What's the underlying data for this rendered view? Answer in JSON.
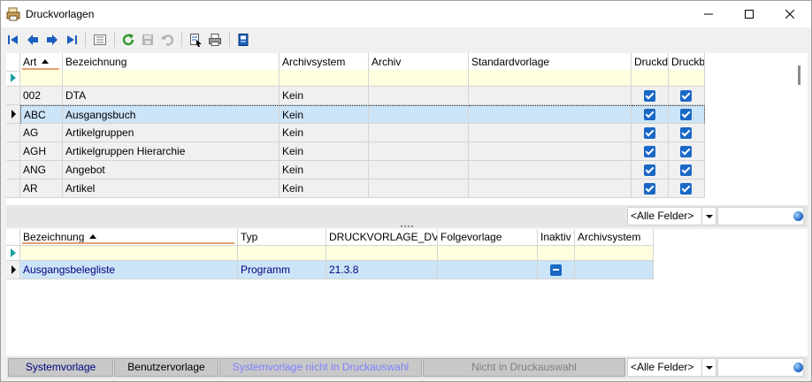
{
  "window": {
    "title": "Druckvorlagen"
  },
  "upper_grid": {
    "columns": [
      "Art",
      "Bezeichnung",
      "Archivsystem",
      "Archiv",
      "Standardvorlage",
      "Druckdi",
      "Druckbe"
    ],
    "rows": [
      {
        "art": "002",
        "bezeichnung": "DTA",
        "archivsystem": "Kein"
      },
      {
        "art": "ABC",
        "bezeichnung": "Ausgangsbuch",
        "archivsystem": "Kein"
      },
      {
        "art": "AG",
        "bezeichnung": "Artikelgruppen",
        "archivsystem": "Kein"
      },
      {
        "art": "AGH",
        "bezeichnung": "Artikelgruppen Hierarchie",
        "archivsystem": "Kein"
      },
      {
        "art": "ANG",
        "bezeichnung": "Angebot",
        "archivsystem": "Kein"
      },
      {
        "art": "AR",
        "bezeichnung": "Artikel",
        "archivsystem": "Kein"
      }
    ],
    "filter": "<Alle Felder>"
  },
  "lower_grid": {
    "columns": [
      "Bezeichnung",
      "Typ",
      "DRUCKVORLAGE_DV_R",
      "Folgevorlage",
      "Inaktiv",
      "Archivsystem"
    ],
    "rows": [
      {
        "bezeichnung": "Ausgangsbelegliste",
        "typ": "Programm",
        "dv": "21.3.8"
      }
    ],
    "filter": "<Alle Felder>"
  },
  "legend": {
    "systemvorlage": "Systemvorlage",
    "benutzervorlage": "Benutzervorlage",
    "system_nicht": "Systemvorlage nicht in Druckauswahl",
    "nicht": "Nicht in Druckauswahl"
  },
  "colors": {
    "selected_row": "#cce4f7",
    "accent": "#1a68c6",
    "user_text": "#000080",
    "disabled_text": "#8080ff"
  }
}
